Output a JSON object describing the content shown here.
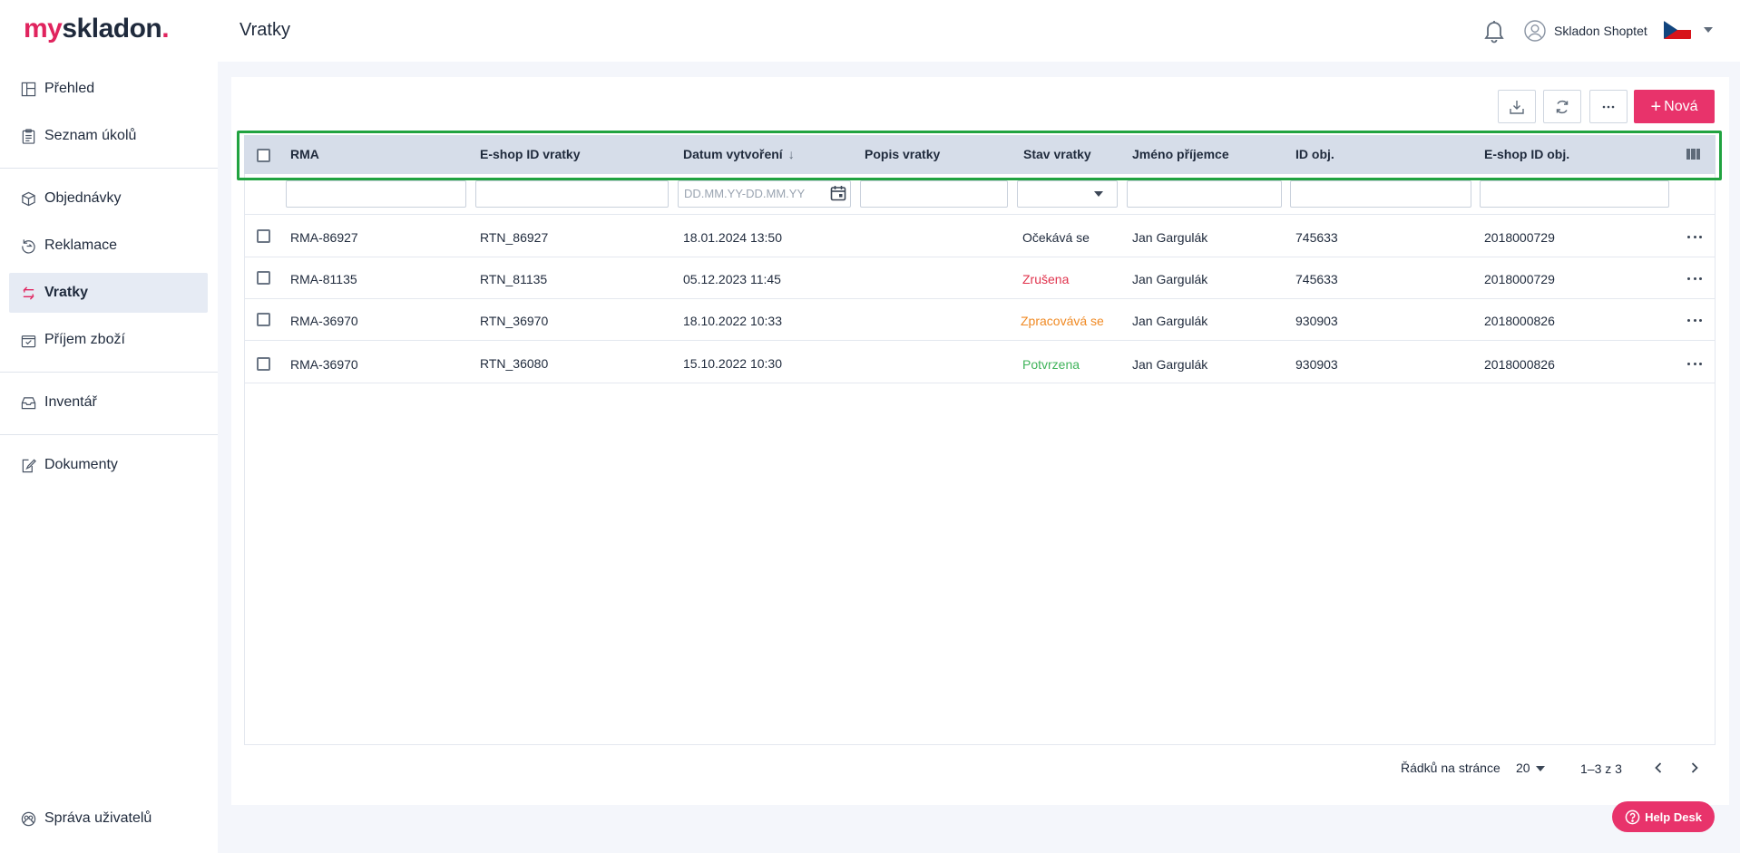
{
  "app": {
    "logo_my": "my",
    "logo_skladon": "skladon",
    "logo_dot": ".",
    "page_title": "Vratky",
    "user_name": "Skladon Shoptet",
    "accent_color": "#e8336b",
    "highlight_color": "#21a340"
  },
  "sidebar": {
    "items": [
      {
        "label": "Přehled",
        "icon": "dashboard-icon"
      },
      {
        "label": "Seznam úkolů",
        "icon": "clipboard-icon"
      },
      {
        "label": "Objednávky",
        "icon": "box-icon"
      },
      {
        "label": "Reklamace",
        "icon": "return-circle-icon"
      },
      {
        "label": "Vratky",
        "icon": "return-arrows-icon",
        "active": true
      },
      {
        "label": "Příjem zboží",
        "icon": "receive-goods-icon"
      },
      {
        "label": "Inventář",
        "icon": "inbox-icon"
      },
      {
        "label": "Dokumenty",
        "icon": "document-edit-icon"
      },
      {
        "label": "Správa uživatelů",
        "icon": "user-management-icon"
      }
    ]
  },
  "toolbar": {
    "new_label": "Nová",
    "new_plus": "+"
  },
  "table": {
    "columns": [
      "RMA",
      "E-shop ID vratky",
      "Datum vytvoření",
      "Popis vratky",
      "Stav vratky",
      "Jméno příjemce",
      "ID obj.",
      "E-shop ID obj."
    ],
    "sort_indicator": "↓",
    "date_placeholder": "DD.MM.YY-DD.MM.YY",
    "rows": [
      {
        "rma": "RMA-86927",
        "eshop_id": "RTN_86927",
        "date": "18.01.2024 13:50",
        "desc": "",
        "status": "Očekává se",
        "recipient": "Jan Gargulák",
        "order_id": "745633",
        "eshop_order_id": "2018000729"
      },
      {
        "rma": "RMA-81135",
        "eshop_id": "RTN_81135",
        "date": "05.12.2023 11:45",
        "desc": "",
        "status": "Zrušena",
        "recipient": "Jan Gargulák",
        "order_id": "745633",
        "eshop_order_id": "2018000729"
      },
      {
        "rma": "RMA-36970",
        "eshop_id": "RTN_36970",
        "date": "18.10.2022 10:33",
        "desc": "",
        "status": "Zpracovává se",
        "recipient": "Jan Gargulák",
        "order_id": "930903",
        "eshop_order_id": "2018000826"
      },
      {
        "rma": "RMA-36970",
        "eshop_id": "RTN_36080",
        "date": "15.10.2022 10:30",
        "desc": "",
        "status": "Potvrzena",
        "recipient": "Jan Gargulák",
        "order_id": "930903",
        "eshop_order_id": "2018000826"
      }
    ]
  },
  "pagination": {
    "rows_per_page_label": "Řádků na stránce",
    "rows_per_page": "20",
    "range": "1–3 z 3"
  },
  "help_desk": {
    "label": "Help Desk"
  }
}
